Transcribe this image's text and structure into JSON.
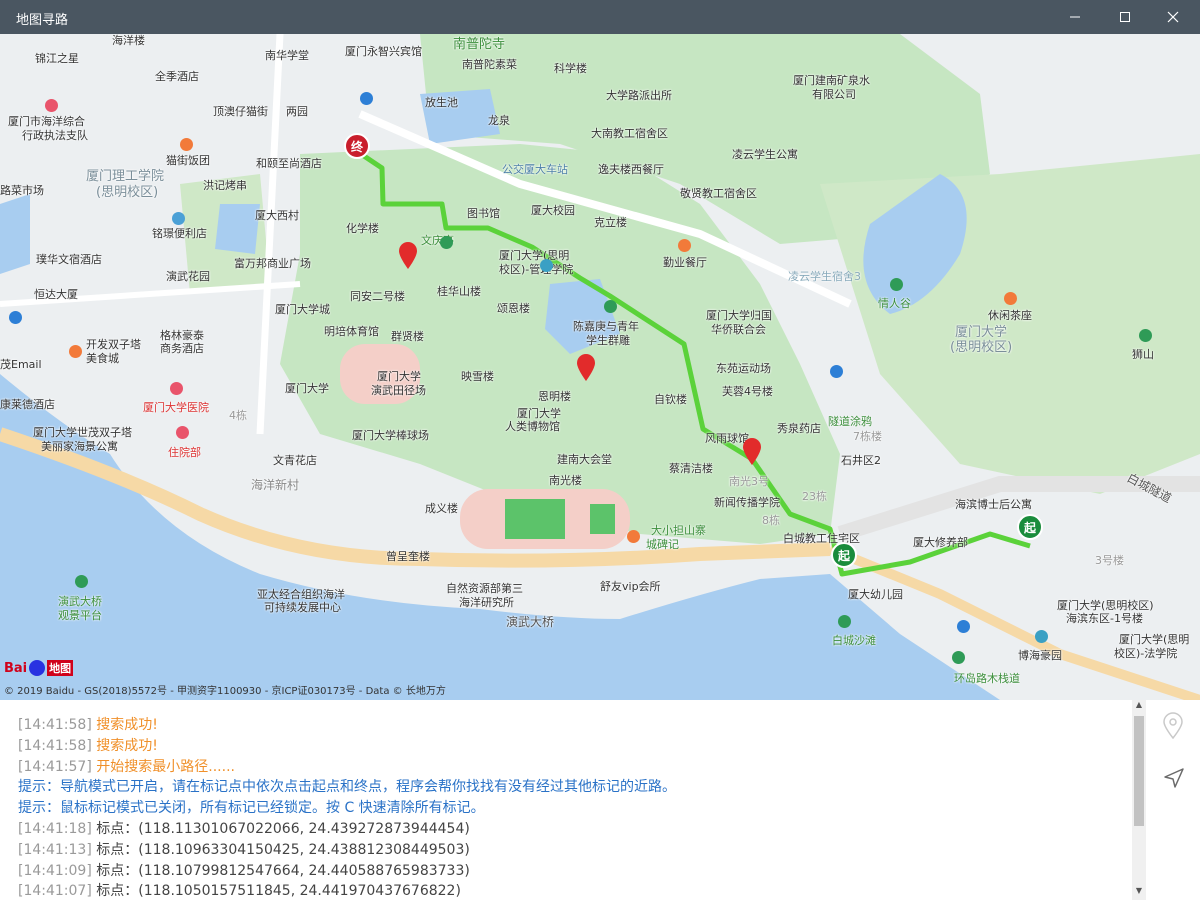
{
  "window": {
    "title": "地图寻路"
  },
  "map": {
    "labels": {
      "l1": "南普陀寺",
      "l2": "南普陀素菜",
      "l3": "科学楼",
      "l4": "厦门建南矿泉水",
      "l5": "有限公司",
      "l6": "大学路派出所",
      "l7": "大南教工宿舍区",
      "l8": "凌云学生公寓",
      "l9": "放生池",
      "l10": "龙泉",
      "l11": "公交厦大车站",
      "l12": "逸夫楼西餐厅",
      "l13": "敬贤教工宿舍区",
      "l14": "锦江之星",
      "l15": "全季酒店",
      "l16": "顶澳仔猫街",
      "l17": "两园",
      "l18": "厦门市海洋综合",
      "l19": "行政执法支队",
      "l20": "猫街饭团",
      "l21": "洪记烤串",
      "l22": "厦门理工学院",
      "l23": "(思明校区)",
      "l24": "和颐至尚酒店",
      "l25": "厦大西村",
      "l26": "铭璟便利店",
      "l27": "璞华文宿酒店",
      "l28": "恒达大厦",
      "l29": "演武花园",
      "l30": "富万邦商业广场",
      "l31": "化学楼",
      "l32": "文庆亭",
      "l33": "图书馆",
      "l34": "厦大校园",
      "l35": "克立楼",
      "l36": "厦门大学(思明",
      "l37": "校区)-管理学院",
      "l38": "勤业餐厅",
      "l39": "凌云学生宿舍3",
      "l40": "情人谷",
      "l41": "休闲茶座",
      "l42": "厦门大学",
      "l43": "(思明校区)",
      "l44": "狮山",
      "l45": "同安二号楼",
      "l46": "桂华山楼",
      "l47": "颂恩楼",
      "l48": "陈嘉庚与青年",
      "l49": "学生群雕",
      "l50": "厦门大学归国",
      "l51": "华侨联合会",
      "l52": "厦门大学城",
      "l53": "明培体育馆",
      "l54": "群贤楼",
      "l55": "格林豪泰",
      "l56": "商务酒店",
      "l57": "开发双子塔",
      "l58": "美食城",
      "l59": "茂Email",
      "l60": "厦门大学",
      "l61": "厦门大学",
      "l62": "演武田径场",
      "l63": "映雪楼",
      "l64": "恩明楼",
      "l65": "东苑运动场",
      "l66": "芙蓉4号楼",
      "l67": "自钦楼",
      "l68": "康莱德酒店",
      "l69": "厦门大学医院",
      "l70": "厦门大学世茂双子塔",
      "l71": "美丽家海景公寓",
      "l72": "住院部",
      "l73": "厦门大学棒球场",
      "l74": "厦门大学",
      "l75": "人类博物馆",
      "l76": "隧道涂鸦",
      "l77": "秀泉药店",
      "l78": "风雨球馆",
      "l79": "石井区2",
      "l80": "文青花店",
      "l81": "海洋新村",
      "l82": "建南大会堂",
      "l83": "蔡清洁楼",
      "l84": "南光楼",
      "l85": "新闻传播学院",
      "l86": "白城隧道",
      "l87": "成义楼",
      "l88": "海滨博士后公寓",
      "l89": "大小担山寨",
      "l90": "城碑记",
      "l91": "白城教工住宅区",
      "l92": "厦大修养部",
      "l93": "曾呈奎楼",
      "l94": "舒友vip会所",
      "l95": "亚太经合组织海洋",
      "l96": "可持续发展中心",
      "l97": "自然资源部第三",
      "l98": "海洋研究所",
      "l99": "厦大幼儿园",
      "l100": "厦门大学(思明校区)",
      "l101": "海滨东区-1号楼",
      "l102": "演武大桥",
      "l103": "演武大桥",
      "l104": "观景平台",
      "l105": "白城沙滩",
      "l106": "厦门大学(思明",
      "l107": "校区)-法学院",
      "l108": "博海豪园",
      "l109": "环岛路木栈道",
      "l110": "南华学堂",
      "l111": "厦门永智兴宾馆",
      "l112": "海洋楼",
      "l113": "路菜市场",
      "l114": "3号楼",
      "l115": "7栋楼",
      "l116": "23栋",
      "l117": "8栋",
      "l118": "4栋",
      "l119": "南光3号"
    },
    "markers": {
      "end_label": "终",
      "start_label": "起",
      "start2_label": "起"
    },
    "logo": {
      "text": "Bai",
      "text2": "地图"
    },
    "copyright": "© 2019 Baidu - GS(2018)5572号 - 甲测资字1100930 - 京ICP证030173号 - Data © 长地万方"
  },
  "log": [
    {
      "time": "[14:41:58]",
      "text": "搜索成功!",
      "color": "orange"
    },
    {
      "time": "[14:41:58]",
      "text": "搜索成功!",
      "color": "orange"
    },
    {
      "time": "[14:41:57]",
      "text": "开始搜索最小路径......",
      "color": "orange"
    },
    {
      "time": "",
      "text": "提示：导航模式已开启，请在标记点中依次点击起点和终点，程序会帮你找找有没有经过其他标记的近路。",
      "color": "blue"
    },
    {
      "time": "",
      "text": "提示：鼠标标记模式已关闭，所有标记已经锁定。按 C 快速清除所有标记。",
      "color": "blue"
    },
    {
      "time": "[14:41:18]",
      "text": "标点：(118.11301067022066, 24.439272873944454)",
      "color": "gray"
    },
    {
      "time": "[14:41:13]",
      "text": "标点：(118.10963304150425, 24.438812308449503)",
      "color": "gray"
    },
    {
      "time": "[14:41:09]",
      "text": "标点：(118.10799812547664, 24.440588765983733)",
      "color": "gray"
    },
    {
      "time": "[14:41:07]",
      "text": "标点：(118.1050157511845, 24.441970437676822)",
      "color": "gray"
    }
  ],
  "colors": {
    "titlebar": "#4a5661",
    "route": "#5bd23a",
    "water": "#a8cdf0",
    "green": "#c6e6c2",
    "marker": "#e22b2b"
  }
}
